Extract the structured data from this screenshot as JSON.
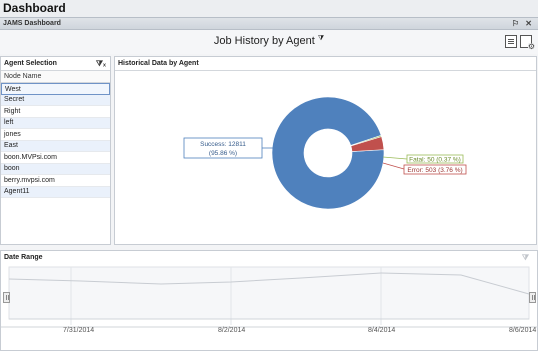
{
  "app": {
    "title": "Dashboard"
  },
  "doc_tab": {
    "label": "JAMS Dashboard",
    "pin": "⚐",
    "close": "✕"
  },
  "header": {
    "title": "Job History by Agent",
    "filter_glyph": "⧩"
  },
  "agent_panel": {
    "title": "Agent Selection",
    "column": "Node Name",
    "rows": [
      "West",
      "Secret",
      "Right",
      "left",
      "jones",
      "East",
      "boon.MVPsi.com",
      "boon",
      "berry.mvpsi.com",
      "Agent11"
    ],
    "selected_index": 0
  },
  "chart_panel": {
    "title": "Historical Data by Agent"
  },
  "chart_data": {
    "type": "pie",
    "style": "donut",
    "slices": [
      {
        "label": "Success",
        "value": 12811,
        "percent_text": "(95.86 %)",
        "color": "#4f81bd",
        "callout": "Success: 12811",
        "callout2": "(95.86 %)"
      },
      {
        "label": "Fatal",
        "value": 50,
        "percent_text": "(0.37 %)",
        "color": "#9bbb59",
        "callout": "Fatal: 50 (0.37 %)"
      },
      {
        "label": "Error",
        "value": 503,
        "percent_text": "(3.76 %)",
        "color": "#c0504d",
        "callout": "Error: 503 (3.76 %)"
      }
    ]
  },
  "date_panel": {
    "title": "Date Range",
    "ticks": [
      "7/31/2014",
      "8/2/2014",
      "8/4/2014",
      "8/6/2014"
    ]
  }
}
